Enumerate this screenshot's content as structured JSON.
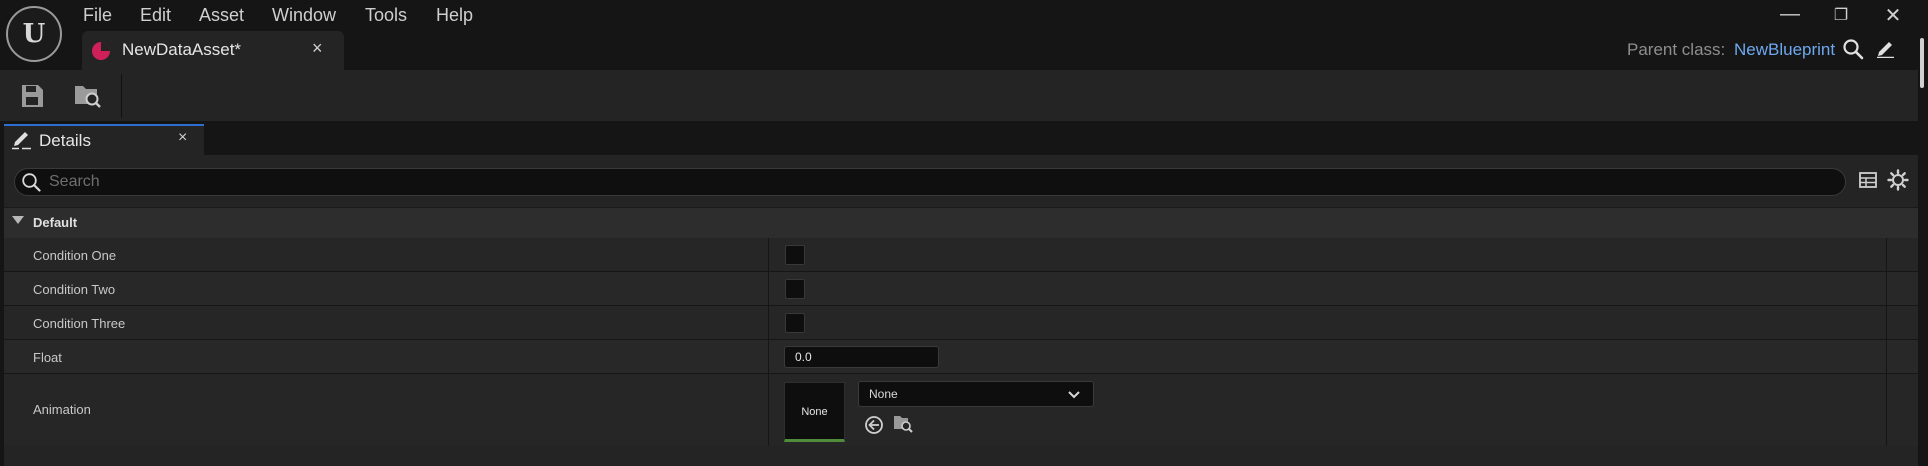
{
  "app": {
    "logo_text": "U",
    "menu": [
      "File",
      "Edit",
      "Asset",
      "Window",
      "Tools",
      "Help"
    ],
    "document_tab": {
      "label": "NewDataAsset*",
      "close": "×"
    },
    "window_controls": {
      "minimize": "—",
      "restore": "❐",
      "close": "✕"
    },
    "parent_class": {
      "label": "Parent class:",
      "value": "NewBlueprint"
    }
  },
  "toolbar": {
    "save_icon": "save-icon",
    "browse_icon": "browse-to-asset-icon"
  },
  "details": {
    "tab_label": "Details",
    "tab_close": "×",
    "search_placeholder": "Search",
    "category": "Default",
    "properties": {
      "condition_one": {
        "name": "Condition One",
        "checked": false
      },
      "condition_two": {
        "name": "Condition Two",
        "checked": false
      },
      "condition_three": {
        "name": "Condition Three",
        "checked": false
      },
      "float": {
        "name": "Float",
        "value": "0.0"
      },
      "animation": {
        "name": "Animation",
        "thumbnail_label": "None",
        "selected": "None"
      }
    }
  },
  "colors": {
    "accent_blue": "#2d6fd1",
    "link_blue": "#6ea8f0",
    "asset_icon": "#d0205a",
    "thumbnail_underline": "#4f8b3a"
  }
}
